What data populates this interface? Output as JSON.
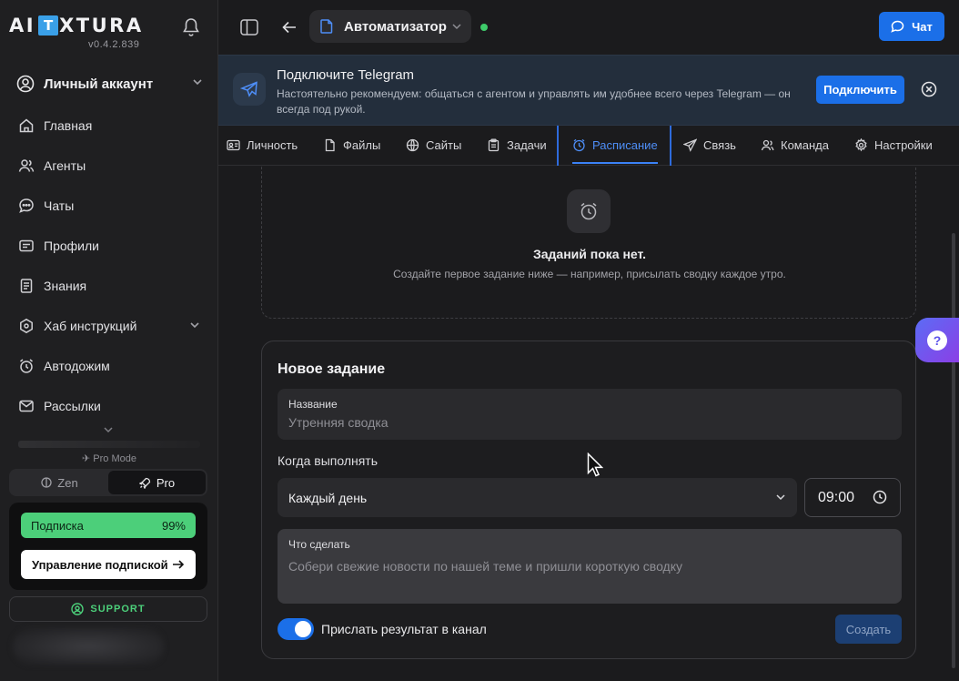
{
  "sidebar": {
    "logo_left": "AI",
    "logo_box": "T",
    "logo_right": "XTURA",
    "version": "v0.4.2.839",
    "account_label": "Личный аккаунт",
    "items": [
      {
        "label": "Главная",
        "icon": "home-icon"
      },
      {
        "label": "Агенты",
        "icon": "users-icon"
      },
      {
        "label": "Чаты",
        "icon": "chat-icon"
      },
      {
        "label": "Профили",
        "icon": "profile-card-icon"
      },
      {
        "label": "Знания",
        "icon": "document-icon"
      },
      {
        "label": "Хаб инструкций",
        "icon": "hub-icon"
      },
      {
        "label": "Автодожим",
        "icon": "alarm-icon"
      },
      {
        "label": "Рассылки",
        "icon": "mail-icon"
      }
    ],
    "pro_mode_label": "Pro Mode",
    "mode_zen": "Zen",
    "mode_pro": "Pro",
    "subscription_label": "Подписка",
    "subscription_percent": "99%",
    "subscription_progress": 0.99,
    "manage_label": "Управление подпиской",
    "support_label": "SUPPORT"
  },
  "topbar": {
    "agent_name": "Автоматизатор",
    "chat_label": "Чат"
  },
  "banner": {
    "title": "Подключите Telegram",
    "description": "Настоятельно рекомендуем: общаться с агентом и управлять им удобнее всего через Telegram — он всегда под рукой.",
    "connect_label": "Подключить"
  },
  "tabs": [
    {
      "label": "Личность",
      "icon": "id-card-icon"
    },
    {
      "label": "Файлы",
      "icon": "file-icon"
    },
    {
      "label": "Сайты",
      "icon": "globe-icon"
    },
    {
      "label": "Задачи",
      "icon": "clipboard-icon"
    },
    {
      "label": "Расписание",
      "icon": "alarm-icon",
      "active": true
    },
    {
      "label": "Связь",
      "icon": "send-icon"
    },
    {
      "label": "Команда",
      "icon": "team-icon"
    },
    {
      "label": "Настройки",
      "icon": "gear-icon"
    }
  ],
  "empty_state": {
    "title": "Заданий пока нет.",
    "subtitle": "Создайте первое задание ниже — например, присылать сводку каждое утро."
  },
  "form": {
    "title": "Новое задание",
    "name_label": "Название",
    "name_placeholder": "Утренняя сводка",
    "when_label": "Когда выполнять",
    "schedule_value": "Каждый день",
    "time_value": "09:00",
    "task_label": "Что сделать",
    "task_placeholder": "Собери свежие новости по нашей теме и пришли короткую сводку",
    "send_to_channel_label": "Прислать результат в канал",
    "send_to_channel_on": true,
    "create_label": "Создать"
  },
  "colors": {
    "accent": "#1b6fe8",
    "active_tab": "#4e8ef7",
    "subscription": "#4ccf7a",
    "status_online": "#3ecb6a"
  }
}
